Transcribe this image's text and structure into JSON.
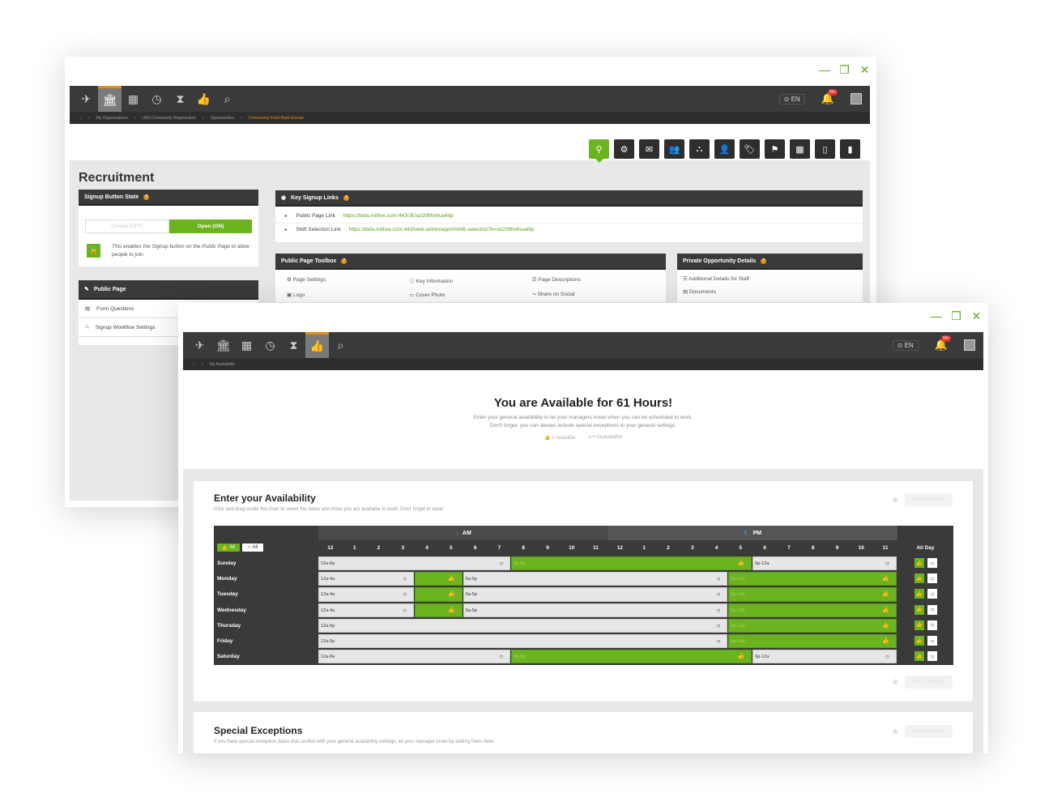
{
  "window1": {
    "nav_icons": [
      "plane-icon",
      "bank-icon",
      "calendar-icon",
      "clock-icon",
      "hourglass-icon",
      "thumbs-up-icon",
      "search-icon"
    ],
    "lang": "EN",
    "badge": "99+",
    "breadcrumb": [
      "My Organizations",
      "LMS Community Organization",
      "Opportunities",
      "Community Food Bank Events"
    ],
    "title": "Recruitment",
    "signup_state": {
      "header": "Signup Button State",
      "closed_label": "Closed (OFF)",
      "open_label": "Open (ON)",
      "desc": "This enables the Signup button on the Public Page to allow people to join."
    },
    "public_page": {
      "header": "Public Page",
      "items": [
        "Form Questions",
        "Signup Workflow Settings"
      ]
    },
    "key_links": {
      "header": "Key Signup Links",
      "public_label": "Public Page Link",
      "public_url": "https://beta.initlive.com:443/JE/az209hx6ua4itp",
      "shift_label": "Shift Selection Link",
      "shift_url": "https://beta.initlive.com:443/web-admin/app/#/shift-selection?k=az209hx6ua4itp"
    },
    "toolbox": {
      "header": "Public Page Toolbox",
      "items": [
        "Page Settings",
        "Key Information",
        "Page Descriptions",
        "Logo",
        "Cover Photo",
        "Share on Social"
      ]
    },
    "private": {
      "header": "Private Opportunity Details",
      "items": [
        "Additional Details for Staff",
        "Documents"
      ]
    }
  },
  "window2": {
    "breadcrumb": "My Availability",
    "headline": "You are Available for 61 Hours!",
    "sub1": "Enter your general availability to let your managers know when you can be scheduled to work.",
    "sub2": "Don't forget, you can always include special exceptions to your general settings.",
    "legend_available": "= Available",
    "legend_unavailable": "= Unavailable",
    "enter_title": "Enter your Availability",
    "enter_desc": "Click and drag inside the chart to select the dates and times you are available to work. Don't forget to save!",
    "save_label": "Save Changes",
    "am": "AM",
    "pm": "PM",
    "all": "All",
    "all_day": "All Day",
    "hours": [
      "12",
      "1",
      "2",
      "3",
      "4",
      "5",
      "6",
      "7",
      "8",
      "9",
      "10",
      "11",
      "12",
      "1",
      "2",
      "3",
      "4",
      "5",
      "6",
      "7",
      "8",
      "9",
      "10",
      "11"
    ],
    "days": [
      {
        "name": "Sunday",
        "blocks": [
          {
            "s": 0,
            "e": 8,
            "t": "12a-8a",
            "av": false
          },
          {
            "s": 8,
            "e": 18,
            "t": "8a-6p",
            "av": true
          },
          {
            "s": 18,
            "e": 24,
            "t": "6p-12a",
            "av": false
          }
        ]
      },
      {
        "name": "Monday",
        "blocks": [
          {
            "s": 0,
            "e": 4,
            "t": "12a-4a",
            "av": false
          },
          {
            "s": 4,
            "e": 6,
            "t": "",
            "av": true
          },
          {
            "s": 6,
            "e": 17,
            "t": "6a-5p",
            "av": false
          },
          {
            "s": 17,
            "e": 24,
            "t": "5p-12a",
            "av": true
          }
        ]
      },
      {
        "name": "Tuesday",
        "blocks": [
          {
            "s": 0,
            "e": 4,
            "t": "12a-4a",
            "av": false
          },
          {
            "s": 4,
            "e": 6,
            "t": "",
            "av": true
          },
          {
            "s": 6,
            "e": 17,
            "t": "6a-5p",
            "av": false
          },
          {
            "s": 17,
            "e": 24,
            "t": "5p-12a",
            "av": true
          }
        ]
      },
      {
        "name": "Wednesday",
        "blocks": [
          {
            "s": 0,
            "e": 4,
            "t": "12a-4a",
            "av": false
          },
          {
            "s": 4,
            "e": 6,
            "t": "",
            "av": true
          },
          {
            "s": 6,
            "e": 17,
            "t": "6a-5p",
            "av": false
          },
          {
            "s": 17,
            "e": 24,
            "t": "5p-12a",
            "av": true
          }
        ]
      },
      {
        "name": "Thursday",
        "blocks": [
          {
            "s": 0,
            "e": 17,
            "t": "12a-5p",
            "av": false
          },
          {
            "s": 17,
            "e": 24,
            "t": "5p-12a",
            "av": true
          }
        ]
      },
      {
        "name": "Friday",
        "blocks": [
          {
            "s": 0,
            "e": 17,
            "t": "12a-5p",
            "av": false
          },
          {
            "s": 17,
            "e": 24,
            "t": "5p-12a",
            "av": true
          }
        ]
      },
      {
        "name": "Saturday",
        "blocks": [
          {
            "s": 0,
            "e": 8,
            "t": "12a-8a",
            "av": false
          },
          {
            "s": 8,
            "e": 18,
            "t": "8a-6p",
            "av": true
          },
          {
            "s": 18,
            "e": 24,
            "t": "6p-12a",
            "av": false
          }
        ]
      }
    ],
    "exceptions_title": "Special Exceptions",
    "exceptions_desc": "If you have special exception dates that conflict with your general availability settings, let your manager know by adding them here."
  },
  "colors": {
    "green": "#6cb320",
    "orange": "#e08e0b",
    "dark": "#3a3a3a"
  }
}
